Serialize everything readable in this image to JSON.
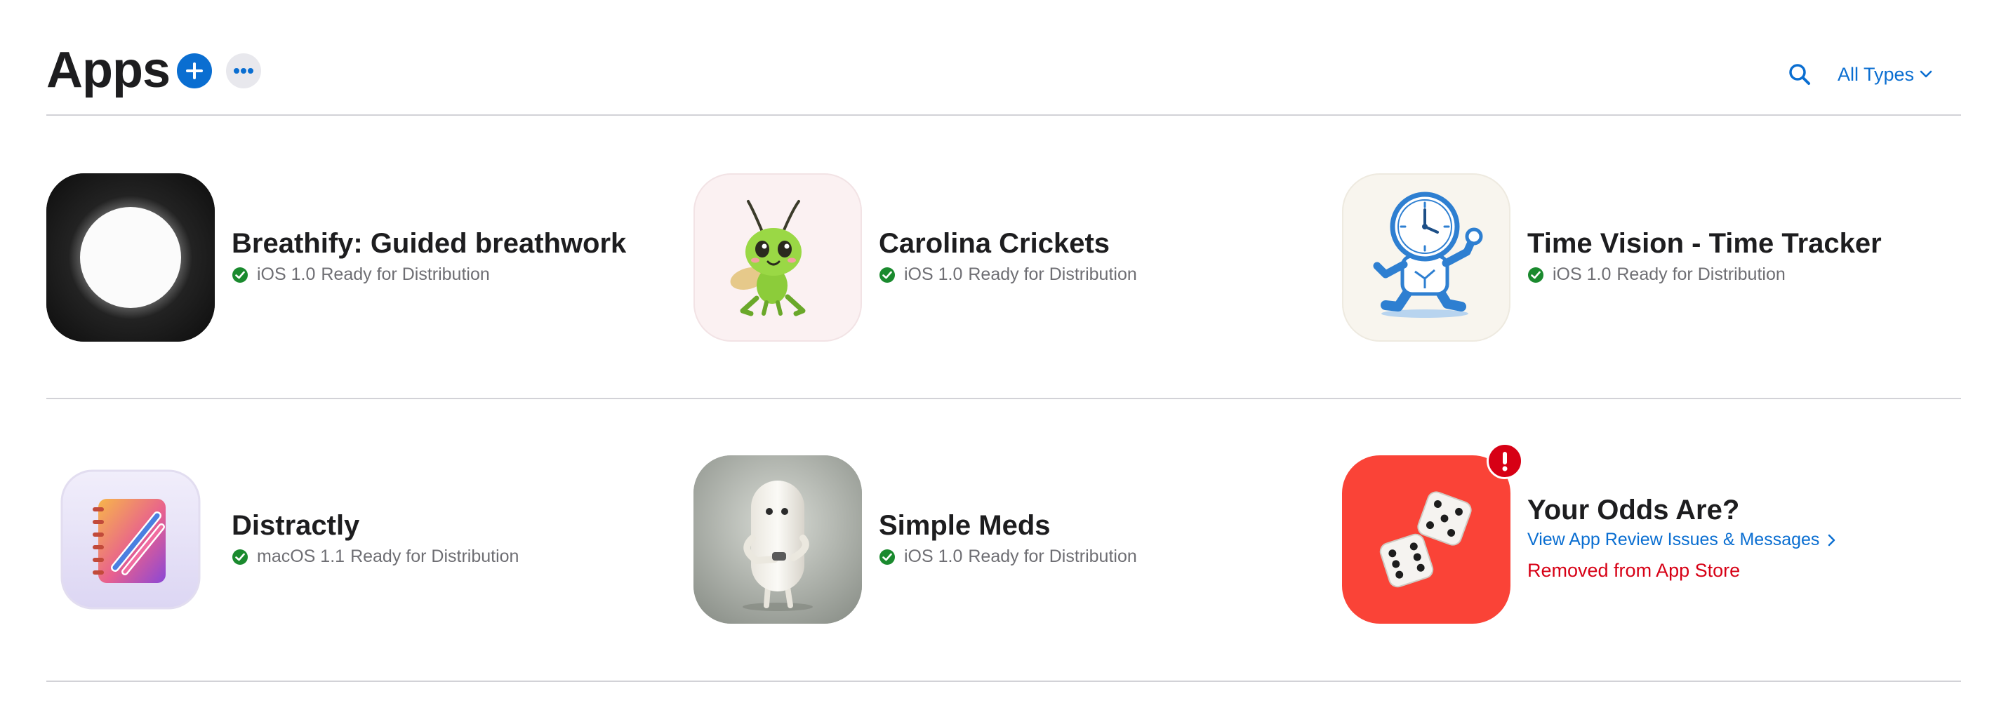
{
  "header": {
    "title": "Apps",
    "add_icon": "plus-circle-icon",
    "more_icon": "ellipsis-icon",
    "search_icon": "magnifying-glass-icon",
    "filter_label": "All Types",
    "filter_icon": "chevron-down-icon"
  },
  "colors": {
    "accent": "#0a6ed1",
    "ready": "#1a8a2e",
    "removed": "#d70015",
    "divider": "#d2d2d7"
  },
  "apps": [
    {
      "name": "Breathify: Guided breathwork",
      "platform": "iOS 1.0",
      "status": "Ready for Distribution",
      "icon": "white-circle-on-black-icon"
    },
    {
      "name": "Carolina Crickets",
      "platform": "iOS 1.0",
      "status": "Ready for Distribution",
      "icon": "cartoon-cricket-icon"
    },
    {
      "name": "Time Vision - Time Tracker",
      "platform": "iOS 1.0",
      "status": "Ready for Distribution",
      "icon": "running-clock-icon"
    },
    {
      "name": "Distractly",
      "platform": "macOS 1.1",
      "status": "Ready for Distribution",
      "icon": "notebook-pencil-icon"
    },
    {
      "name": "Simple Meds",
      "platform": "iOS 1.0",
      "status": "Ready for Distribution",
      "icon": "pill-character-icon"
    },
    {
      "name": "Your Odds Are?",
      "review_link": "View App Review Issues & Messages",
      "status": "Removed from App Store",
      "icon": "dice-icon",
      "badge_icon": "exclamation-icon"
    }
  ]
}
